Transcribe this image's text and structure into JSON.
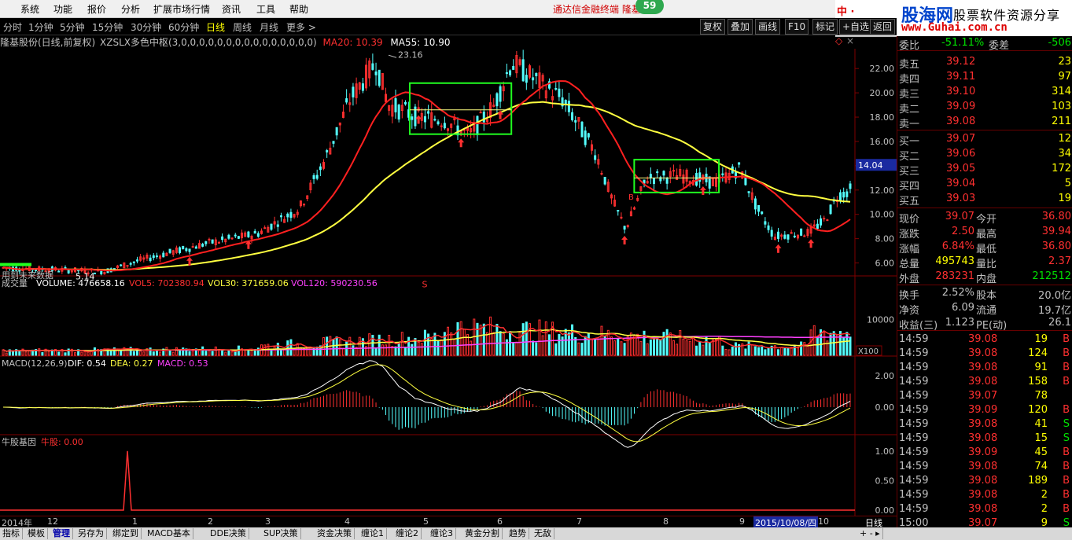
{
  "menu": [
    "系统",
    "功能",
    "报价",
    "分析",
    "扩展市场行情",
    "资讯",
    "工具",
    "帮助"
  ],
  "promo": "通达信金融终端  隆基",
  "notification_count": "59",
  "logo": {
    "brand": "中 ·",
    "site_name": "股海网",
    "slogan": "股票软件资源分享",
    "url": "www.Guhai.com.cn"
  },
  "periods": [
    "分时",
    "1分钟",
    "5分钟",
    "15分钟",
    "30分钟",
    "60分钟",
    "日线",
    "周线",
    "月线",
    "更多 >"
  ],
  "active_period": "日线",
  "toolbar_buttons": [
    "复权",
    "叠加",
    "画线",
    "F10",
    "标记",
    "+自选",
    "返回"
  ],
  "title": {
    "stock": "隆基股份(日线,前复权)",
    "indicator": "XZSLX多色中枢(3,0,0,0,0,0,0,0,0,0,0,0,0,0,0,0)",
    "ma20": "MA20: 10.39",
    "ma55": "MA55: 10.90"
  },
  "price_axis": [
    "22.00",
    "20.00",
    "18.00",
    "16.00",
    "14.00",
    "12.00",
    "10.00",
    "8.00",
    "6.00"
  ],
  "current_price_tag": "14.04",
  "peak_label": "23.16",
  "low_label": "5.14",
  "low_note": "用到未来数据",
  "signal_letter": "S",
  "buy_marker_letter": "B",
  "volume": {
    "label": "成交量",
    "volume": "VOLUME: 476658.16",
    "vol5": "VOL5: 702380.94",
    "vol30": "VOL30: 371659.06",
    "vol120": "VOL120: 590230.56",
    "axis": "10000",
    "unit": "X100"
  },
  "macd": {
    "label": "MACD(12,26,9)",
    "dif": "DIF: 0.54",
    "dea": "DEA: 0.27",
    "macd": "MACD: 0.53",
    "axis": [
      "2.00",
      "0.00"
    ]
  },
  "gene": {
    "label": "牛股基因",
    "value": "牛股: 0.00",
    "axis": [
      "1.00",
      "0.50",
      "0.00"
    ]
  },
  "date_axis": [
    "2014年",
    "12",
    "1",
    "2",
    "3",
    "4",
    "5",
    "6",
    "7",
    "8",
    "9",
    "10"
  ],
  "cursor_date": "2015/10/08/四",
  "cursor_period": "日线",
  "quote": {
    "top_partial": {
      "label": "委比",
      "value": "-51.11%",
      "label2": "委差",
      "value2": "-506"
    },
    "sells": [
      {
        "label": "卖五",
        "price": "39.12",
        "vol": "23"
      },
      {
        "label": "卖四",
        "price": "39.11",
        "vol": "97"
      },
      {
        "label": "卖三",
        "price": "39.10",
        "vol": "314"
      },
      {
        "label": "卖二",
        "price": "39.09",
        "vol": "103"
      },
      {
        "label": "卖一",
        "price": "39.08",
        "vol": "211"
      }
    ],
    "buys": [
      {
        "label": "买一",
        "price": "39.07",
        "vol": "12"
      },
      {
        "label": "买二",
        "price": "39.06",
        "vol": "34"
      },
      {
        "label": "买三",
        "price": "39.05",
        "vol": "172"
      },
      {
        "label": "买四",
        "price": "39.04",
        "vol": "5"
      },
      {
        "label": "买五",
        "price": "39.03",
        "vol": "19"
      }
    ],
    "stats": [
      {
        "l1": "现价",
        "v1": "39.07",
        "l2": "今开",
        "v2": "36.80",
        "c1": "#ff3030",
        "c2": "#ff3030"
      },
      {
        "l1": "涨跌",
        "v1": "2.50",
        "l2": "最高",
        "v2": "39.94",
        "c1": "#ff3030",
        "c2": "#ff3030"
      },
      {
        "l1": "涨幅",
        "v1": "6.84%",
        "l2": "最低",
        "v2": "36.80",
        "c1": "#ff3030",
        "c2": "#ff3030"
      },
      {
        "l1": "总量",
        "v1": "495743",
        "l2": "量比",
        "v2": "2.37",
        "c1": "#ffff00",
        "c2": "#ff3030"
      },
      {
        "l1": "外盘",
        "v1": "283231",
        "l2": "内盘",
        "v2": "212512",
        "c1": "#ff3030",
        "c2": "#00e000"
      }
    ],
    "stats2": [
      {
        "l1": "换手",
        "v1": "2.52%",
        "l2": "股本",
        "v2": "20.0亿"
      },
      {
        "l1": "净资",
        "v1": "6.09",
        "l2": "流通",
        "v2": "19.7亿"
      },
      {
        "l1": "收益(三)",
        "v1": "1.123",
        "l2": "PE(动)",
        "v2": "26.1"
      }
    ],
    "ticks": [
      {
        "t": "14:59",
        "p": "39.08",
        "v": "19",
        "s": "B"
      },
      {
        "t": "14:59",
        "p": "39.08",
        "v": "124",
        "s": "B"
      },
      {
        "t": "14:59",
        "p": "39.08",
        "v": "91",
        "s": "B"
      },
      {
        "t": "14:59",
        "p": "39.08",
        "v": "158",
        "s": "B"
      },
      {
        "t": "14:59",
        "p": "39.07",
        "v": "78",
        "s": ""
      },
      {
        "t": "14:59",
        "p": "39.09",
        "v": "120",
        "s": "B"
      },
      {
        "t": "14:59",
        "p": "39.08",
        "v": "41",
        "s": "S"
      },
      {
        "t": "14:59",
        "p": "39.08",
        "v": "15",
        "s": "S"
      },
      {
        "t": "14:59",
        "p": "39.09",
        "v": "45",
        "s": "B"
      },
      {
        "t": "14:59",
        "p": "39.08",
        "v": "74",
        "s": "B"
      },
      {
        "t": "14:59",
        "p": "39.08",
        "v": "189",
        "s": "B"
      },
      {
        "t": "14:59",
        "p": "39.08",
        "v": "2",
        "s": "B"
      },
      {
        "t": "14:59",
        "p": "39.08",
        "v": "2",
        "s": "B"
      },
      {
        "t": "15:00",
        "p": "39.07",
        "v": "9",
        "s": "S"
      }
    ]
  },
  "bottom_tabs": [
    "指标",
    "模板",
    "管理",
    "另存为",
    "绑定到",
    "MACD基本",
    "DDE决策",
    "SUP决策",
    "资金决策",
    "缠论1",
    "缠论2",
    "缠论3",
    "黄金分割",
    "趋势",
    "无敌"
  ],
  "active_tab": "管理",
  "colors": {
    "up": "#ff3030",
    "down": "#54ffff",
    "ma20": "#ff2020",
    "ma55": "#ffff40",
    "box": "#20ff20",
    "accent": "#ffff00"
  }
}
